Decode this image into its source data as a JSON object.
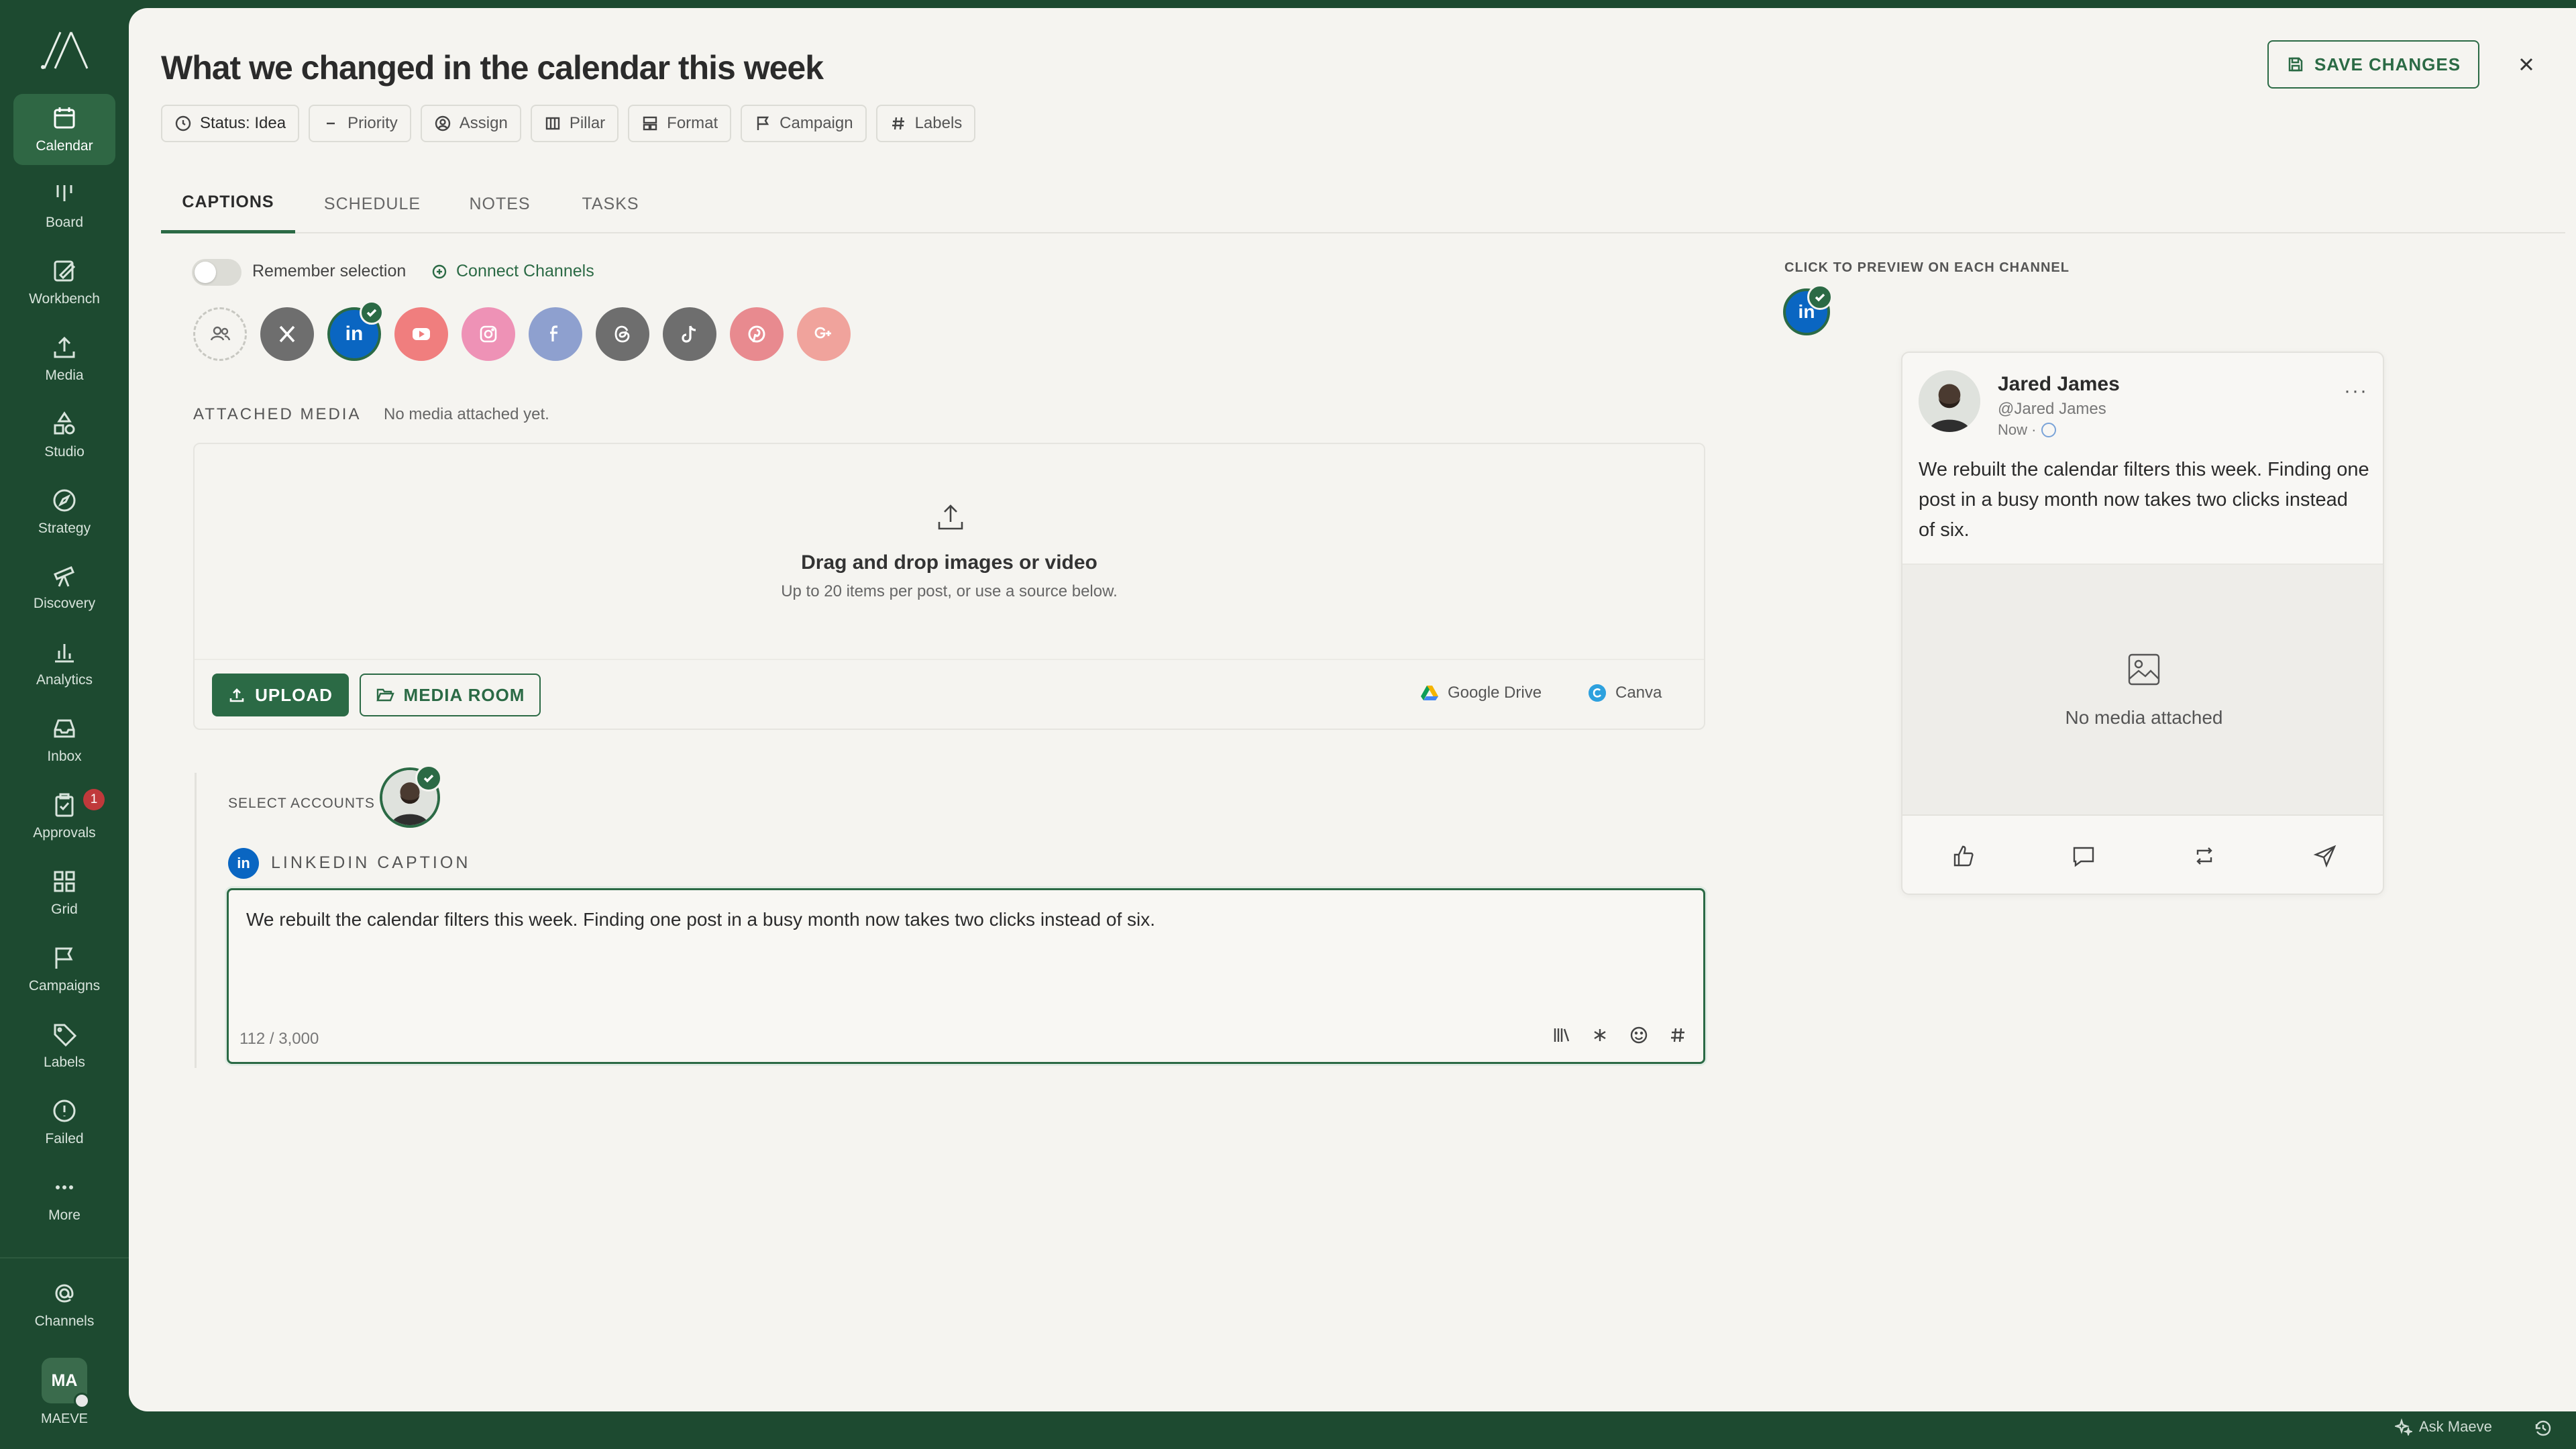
{
  "sidebar": {
    "items": [
      {
        "label": "Calendar",
        "icon": "calendar-icon"
      },
      {
        "label": "Board",
        "icon": "board-icon"
      },
      {
        "label": "Workbench",
        "icon": "workbench-icon"
      },
      {
        "label": "Media",
        "icon": "upload-icon"
      },
      {
        "label": "Studio",
        "icon": "shapes-icon"
      },
      {
        "label": "Strategy",
        "icon": "compass-icon"
      },
      {
        "label": "Discovery",
        "icon": "telescope-icon"
      },
      {
        "label": "Analytics",
        "icon": "bar-chart-icon"
      },
      {
        "label": "Inbox",
        "icon": "inbox-icon"
      },
      {
        "label": "Approvals",
        "icon": "clipboard-check-icon",
        "badge": "1"
      },
      {
        "label": "Grid",
        "icon": "grid-icon"
      },
      {
        "label": "Campaigns",
        "icon": "flag-icon"
      },
      {
        "label": "Labels",
        "icon": "tag-icon"
      },
      {
        "label": "Failed",
        "icon": "alert-circle-icon"
      },
      {
        "label": "More",
        "icon": "more-dots-icon"
      }
    ],
    "channels_label": "Channels",
    "user_initials": "MA",
    "user_name": "MAEVE"
  },
  "post": {
    "title": "What we changed in the calendar this week",
    "chips": {
      "status": "Status: Idea",
      "priority": "Priority",
      "assign": "Assign",
      "pillar": "Pillar",
      "format": "Format",
      "campaign": "Campaign",
      "labels": "Labels"
    },
    "save_label": "SAVE CHANGES"
  },
  "tabs": [
    "CAPTIONS",
    "SCHEDULE",
    "NOTES",
    "TASKS"
  ],
  "captions": {
    "remember_label": "Remember selection",
    "connect_label": "Connect Channels",
    "linkedin_letters": "in",
    "attached_label": "ATTACHED MEDIA",
    "attached_none": "No media attached yet.",
    "drop_title": "Drag and drop images or video",
    "drop_sub": "Up to 20 items per post, or use a source below.",
    "upload_label": "UPLOAD",
    "media_room_label": "MEDIA ROOM",
    "google_drive_label": "Google Drive",
    "canva_label": "Canva",
    "select_accounts_label": "SELECT ACCOUNTS",
    "linkedin_caption_label": "LINKEDIN CAPTION",
    "caption_text": "We rebuilt the calendar filters this week. Finding one post in a busy month now takes two clicks instead of six.",
    "counter": "112 / 3,000"
  },
  "preview": {
    "label": "CLICK TO PREVIEW ON EACH CHANNEL",
    "name": "Jared James",
    "handle": "@Jared James",
    "time": "Now ·",
    "body": "We rebuilt the calendar filters this week. Finding one post in a busy month now takes two clicks instead of six.",
    "no_media": "No media attached"
  },
  "footer": {
    "ask_label": "Ask Maeve"
  },
  "colors": {
    "brand_green": "#1d4a30",
    "accent_green": "#2b6a45",
    "linkedin_blue": "#0a66c2",
    "badge_red": "#c0393b"
  }
}
